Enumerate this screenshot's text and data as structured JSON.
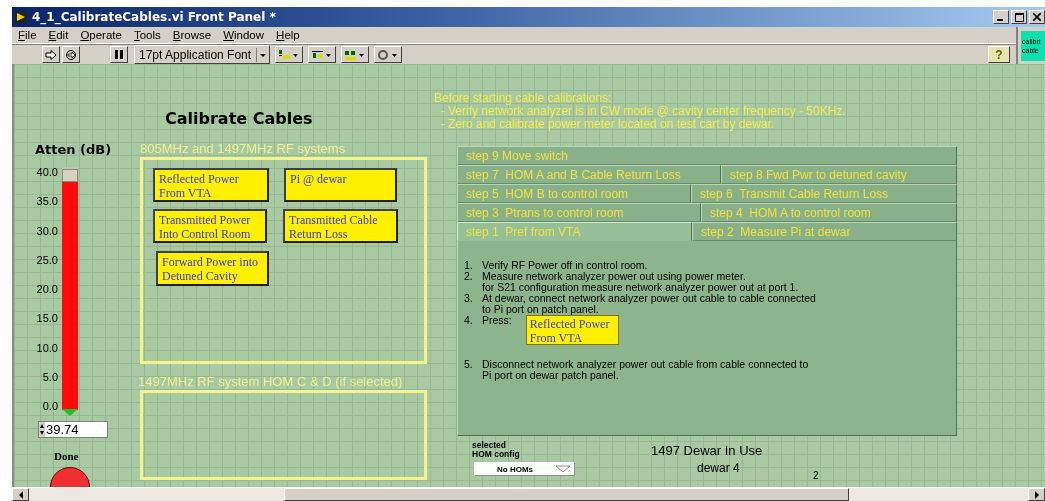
{
  "window": {
    "title": "4_1_CalibrateCables.vi Front Panel *"
  },
  "menu": [
    "File",
    "Edit",
    "Operate",
    "Tools",
    "Browse",
    "Window",
    "Help"
  ],
  "toolbar": {
    "font": "17pt Application Font",
    "help": "?"
  },
  "vi_icon": {
    "lines": [
      "calibrt",
      "cable"
    ]
  },
  "panel": {
    "title": "Calibrate Cables",
    "atten": {
      "label": "Atten (dB)",
      "scale": [
        "40.0",
        "35.0",
        "30.0",
        "25.0",
        "20.0",
        "15.0",
        "10.0",
        "5.0",
        "0.0"
      ],
      "level": 0.9935,
      "value": "39.74"
    },
    "done": {
      "label": "Done"
    },
    "groups": [
      {
        "label": "805MHz and 1497MHz RF systems",
        "buttons": [
          "Reflected Power\nFrom VTA",
          "Pi @ dewar",
          "Transmitted Power\nInto Control Room",
          "Transmitted Cable\nReturn Loss",
          "Forward Power into\nDetuned Cavity"
        ]
      },
      {
        "label": "1497MHz RF system HOM C & D (if selected)"
      }
    ],
    "notes": "Before starting cable calibrations:\n  - Verify network analyzer is in CW mode @ cavity center frequency - 50KHz.\n  - Zero and calibrate power meter located on test cart by dewar.",
    "tab_rows": [
      [
        {
          "label": "step 9 Move switch",
          "selected": false
        }
      ],
      [
        {
          "label": "step 7  HOM A and B Cable Return Loss",
          "selected": false
        },
        {
          "label": "step 8 Fwd Pwr to detuned cavity",
          "selected": false
        }
      ],
      [
        {
          "label": "step 5  HOM B to control room",
          "selected": false
        },
        {
          "label": "step 6  Transmit Cable Return Loss",
          "selected": false
        }
      ],
      [
        {
          "label": "step 3  Ptrans to control room",
          "selected": false
        },
        {
          "label": "step 4  HOM A to control room",
          "selected": false
        }
      ],
      [
        {
          "label": "step 1  Pref from VTA",
          "selected": true
        },
        {
          "label": "step 2  Measure Pi at dewar",
          "selected": false
        }
      ]
    ],
    "steps": [
      {
        "number": "1.",
        "text": "Verify RF Power off in control room."
      },
      {
        "number": "2.",
        "text": "Measure network analyzer power out using power meter.\nfor S21 configuration measure network analyzer power out at port 1."
      },
      {
        "number": "3.",
        "text": "At dewar, connect network analyzer power out cable to cable connected\nto Pi port on patch panel."
      },
      {
        "number": "4.",
        "text": "Press:",
        "button": "Reflected Power\nFrom VTA"
      },
      {
        "number": "5.",
        "text": "Disconnect network analyzer power out cable from cable connected to\nPi port on dewar patch panel."
      }
    ],
    "hom_config": {
      "label": "selected\nHOM config",
      "value": "No HOMs"
    },
    "dewar": {
      "title": "1497 Dewar In Use",
      "name": "dewar 4",
      "number": "2"
    }
  }
}
